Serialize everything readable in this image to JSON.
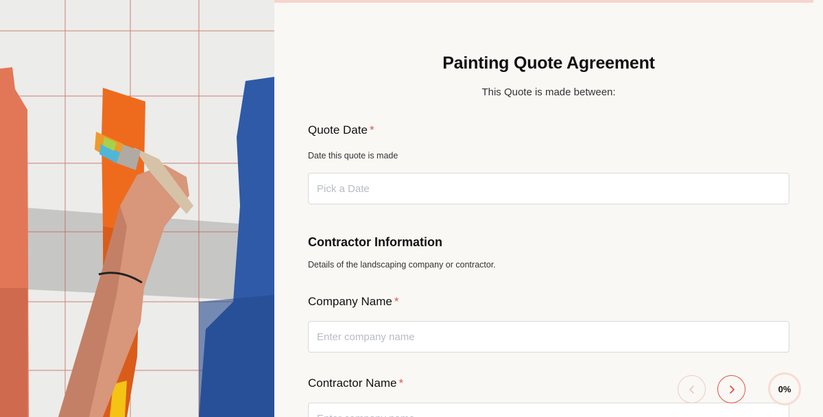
{
  "form": {
    "title": "Painting Quote Agreement",
    "subtitle": "This Quote is made between:",
    "quote_date": {
      "label": "Quote Date",
      "required_mark": "*",
      "hint": "Date this quote is made",
      "placeholder": "Pick a Date"
    },
    "contractor_section": {
      "title": "Contractor Information",
      "hint": "Details of the landscaping company or contractor."
    },
    "company_name": {
      "label": "Company Name",
      "required_mark": "*",
      "placeholder": "Enter company name"
    },
    "contractor_name": {
      "label": "Contractor Name",
      "required_mark": "*",
      "placeholder": "Enter company name"
    }
  },
  "navigation": {
    "prev_icon": "chevron-left-icon",
    "next_icon": "chevron-right-icon"
  },
  "progress": {
    "value": 0,
    "label": "0%"
  },
  "colors": {
    "accent": "#e2533f",
    "required": "#e5534b",
    "background": "#f9f8f5",
    "top_bar": "#f8d4cc"
  }
}
